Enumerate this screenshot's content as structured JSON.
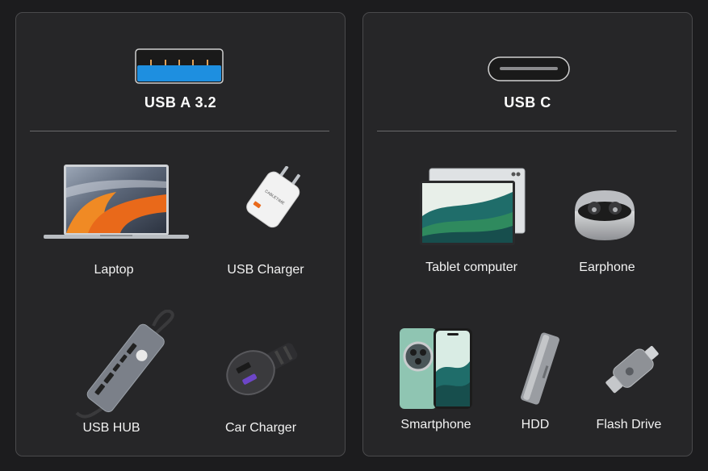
{
  "usb_a": {
    "title": "USB A 3.2",
    "devices": [
      {
        "label": "Laptop",
        "icon": "laptop-icon"
      },
      {
        "label": "USB Charger",
        "icon": "usb-charger-icon"
      },
      {
        "label": "USB HUB",
        "icon": "usb-hub-icon"
      },
      {
        "label": "Car Charger",
        "icon": "car-charger-icon"
      }
    ]
  },
  "usb_c": {
    "title": "USB C",
    "devices": [
      {
        "label": "Tablet computer",
        "icon": "tablet-icon"
      },
      {
        "label": "Earphone",
        "icon": "earphone-icon"
      },
      {
        "label": "Smartphone",
        "icon": "smartphone-icon"
      },
      {
        "label": "HDD",
        "icon": "hdd-icon"
      },
      {
        "label": "Flash Drive",
        "icon": "flash-drive-icon"
      }
    ]
  },
  "colors": {
    "background": "#1c1c1e",
    "panel": "#262628",
    "usb_a_blue": "#1e8fe0",
    "accent_orange": "#f08a24"
  }
}
